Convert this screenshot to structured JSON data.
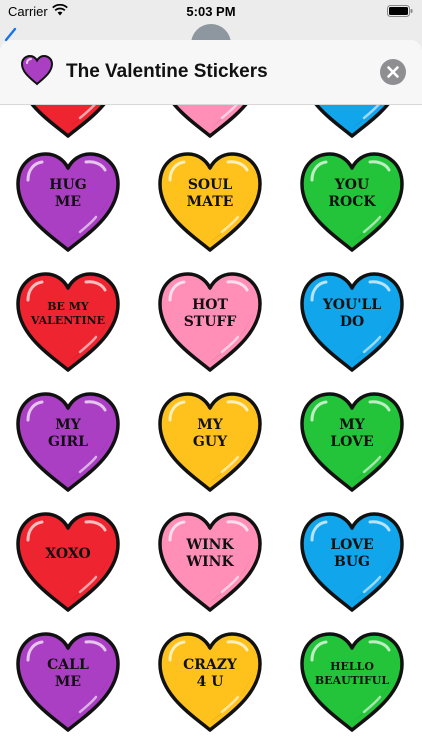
{
  "status_bar": {
    "carrier": "Carrier",
    "time": "5:03 PM"
  },
  "header": {
    "title": "The Valentine Stickers",
    "icon": "purple-heart-icon",
    "close_icon": "close-icon"
  },
  "colors": {
    "purple": "#aa3fc4",
    "yellow": "#ffc21d",
    "green": "#24c43a",
    "red": "#ee2530",
    "pink": "#ff8fb7",
    "blue": "#11a5ec"
  },
  "stickers": [
    {
      "text": "",
      "color": "red"
    },
    {
      "text": "",
      "color": "pink"
    },
    {
      "text": "",
      "color": "blue"
    },
    {
      "text": "HUG\nME",
      "color": "purple"
    },
    {
      "text": "SOUL\nMATE",
      "color": "yellow"
    },
    {
      "text": "YOU\nROCK",
      "color": "green"
    },
    {
      "text": "BE MY\nVALENTINE",
      "color": "red",
      "small": true
    },
    {
      "text": "HOT\nSTUFF",
      "color": "pink"
    },
    {
      "text": "YOU'LL\nDO",
      "color": "blue"
    },
    {
      "text": "MY\nGIRL",
      "color": "purple"
    },
    {
      "text": "MY\nGUY",
      "color": "yellow"
    },
    {
      "text": "MY\nLOVE",
      "color": "green"
    },
    {
      "text": "XOXO",
      "color": "red"
    },
    {
      "text": "WINK\nWINK",
      "color": "pink"
    },
    {
      "text": "LOVE\nBUG",
      "color": "blue"
    },
    {
      "text": "CALL\nME",
      "color": "purple"
    },
    {
      "text": "CRAZY\n4 U",
      "color": "yellow"
    },
    {
      "text": "HELLO\nBEAUTIFUL",
      "color": "green",
      "small": true
    }
  ]
}
